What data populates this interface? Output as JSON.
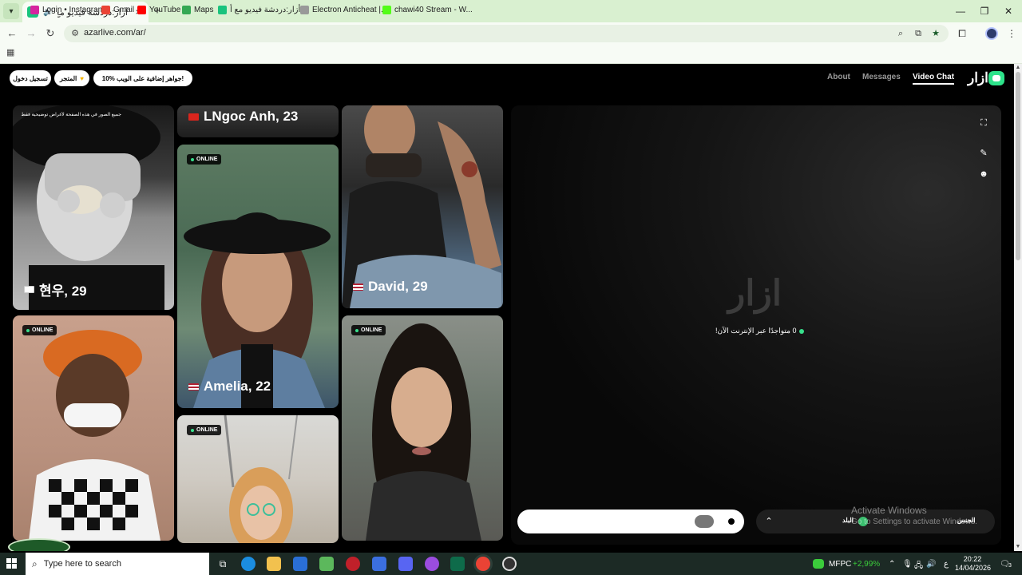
{
  "browser": {
    "tab": {
      "title": "أزار:دردشة فيديو مع أشخاص",
      "audio_icon": "speaker-icon",
      "close": "×"
    },
    "new_tab": "+",
    "url": "azarlive.com/ar/",
    "window_controls": [
      "—",
      "❐",
      "✕"
    ],
    "bookmarks": [
      {
        "label": "Login • Instagram",
        "color": "#d6249f"
      },
      {
        "label": "Gmail",
        "color": "#ea4335"
      },
      {
        "label": "YouTube",
        "color": "#ff0000"
      },
      {
        "label": "Maps",
        "color": "#34a853"
      },
      {
        "label": "أزار:دردشة فيديو مع أ...",
        "color": "#19c37d"
      },
      {
        "label": "Electron Anticheat |...",
        "color": "#999999"
      },
      {
        "label": "chawi40 Stream - W...",
        "color": "#53fc18"
      }
    ]
  },
  "header": {
    "login_label": "تسجيل دخول",
    "store_label": "المتجر",
    "promo_label": "10% جواهر إضافية على الويب!",
    "nav": [
      {
        "label": "About"
      },
      {
        "label": "Messages"
      },
      {
        "label": "Video Chat"
      }
    ],
    "logo": "ازار"
  },
  "cards": {
    "top_banner": "جميع الصور في هذه الصفحة لأغراض توضيحية فقط",
    "online_label": "ONLINE",
    "names": [
      "현우, 29",
      "LNgoc Anh, 23",
      "Amelia, 22",
      "David, 29"
    ]
  },
  "video_panel": {
    "logo": "ازار",
    "status": "0 متواجدًا عبر الإنترنت الآن!",
    "right_bar_label": "الجنس",
    "right_bar_label2": "البلد"
  },
  "watermark": {
    "line1": "Activate Windows",
    "line2": "Go to Settings to activate Windows."
  },
  "taskbar": {
    "search_placeholder": "Type here to search",
    "stock_name": "MFPC",
    "stock_change": "+2,99%",
    "lang": "ع",
    "time": "20:22",
    "date": "14/04/2026",
    "notifications": "3"
  }
}
